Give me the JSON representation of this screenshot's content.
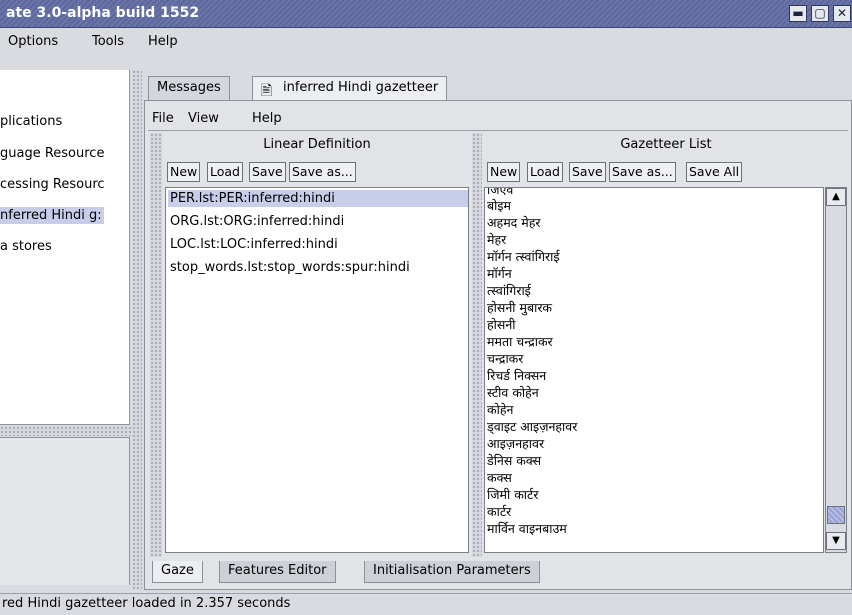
{
  "window": {
    "title": "ate 3.0-alpha build 1552",
    "controls": {
      "minimize": "▬",
      "maximize": "▢",
      "close": "✕"
    }
  },
  "menu": [
    "Options",
    "Tools",
    "Help"
  ],
  "left_tree": {
    "items": [
      {
        "label": "plications",
        "selected": false
      },
      {
        "label": "guage Resource",
        "selected": false
      },
      {
        "label": "cessing Resourc",
        "selected": false
      },
      {
        "label": "nferred Hindi g:",
        "selected": true
      },
      {
        "label": "a stores",
        "selected": false
      }
    ]
  },
  "tabs": {
    "messages": "Messages",
    "doc": "inferred Hindi gazetteer"
  },
  "inner_menu": [
    "File",
    "View",
    "Help"
  ],
  "linear_definition": {
    "title": "Linear Definition",
    "buttons": [
      "New",
      "Load",
      "Save",
      "Save as..."
    ],
    "items": [
      {
        "text": "PER.lst:PER:inferred:hindi",
        "selected": true
      },
      {
        "text": "ORG.lst:ORG:inferred:hindi",
        "selected": false
      },
      {
        "text": "LOC.lst:LOC:inferred:hindi",
        "selected": false
      },
      {
        "text": "stop_words.lst:stop_words:spur:hindi",
        "selected": false
      }
    ]
  },
  "gazetteer_list": {
    "title": "Gazetteer List",
    "buttons": [
      "New",
      "Load",
      "Save",
      "Save as...",
      "Save All"
    ],
    "entries": [
      "जिएव",
      "बोइम",
      "अहमद मेहर",
      "मेहर",
      "मॉर्गन त्स्वांगिराई",
      "मॉर्गन",
      "त्स्वांगिराई",
      "होसनी मुबारक",
      "होसनी",
      "ममता चन्द्राकर",
      "चन्द्राकर",
      "रिचर्ड निक्सन",
      "स्टीव कोहेन",
      "कोहेन",
      "ड्वाइट आइज़नहावर",
      "आइज़नहावर",
      "डेनिस कक्स",
      "कक्स",
      "जिमी कार्टर",
      "कार्टर",
      "मार्विन वाइनबाउम"
    ]
  },
  "bottom_tabs": [
    "Gaze",
    "Features Editor",
    "Initialisation Parameters"
  ],
  "status": "red Hindi gazetteer loaded in 2.357 seconds",
  "colors": {
    "titlebar": "#6a75a9",
    "selection": "#c8cdea"
  }
}
